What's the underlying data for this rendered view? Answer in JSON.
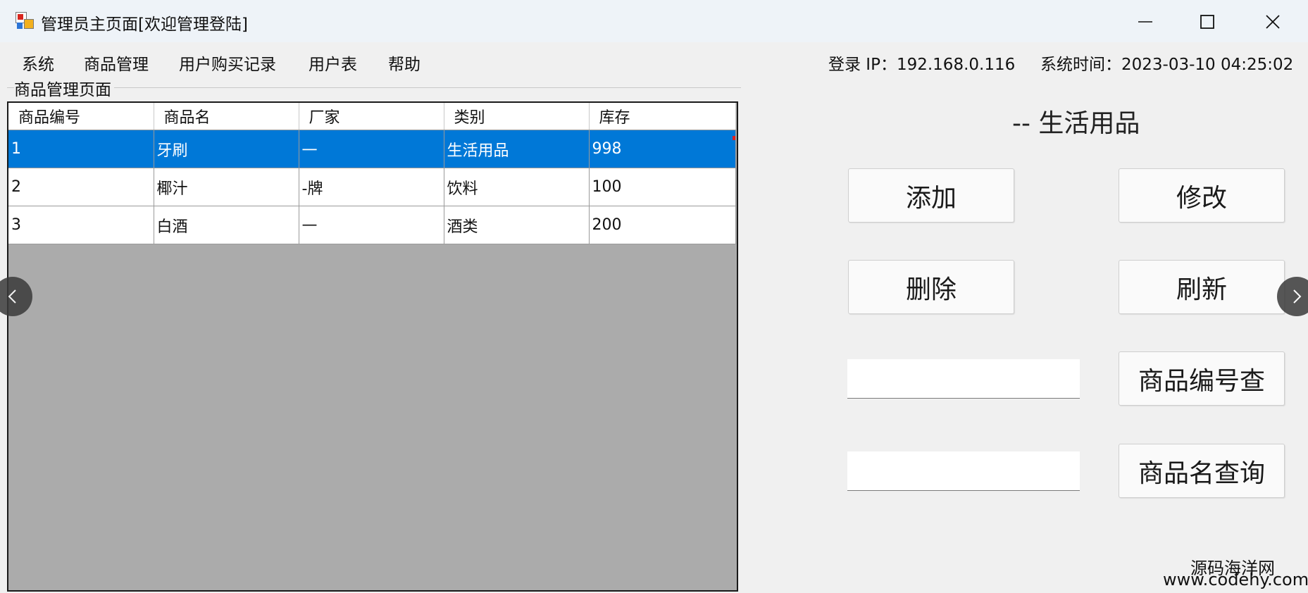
{
  "window": {
    "title": "管理员主页面[欢迎管理登陆]"
  },
  "menu": {
    "items": [
      "系统",
      "商品管理",
      "用户购买记录",
      "用户表",
      "帮助"
    ]
  },
  "status": {
    "login_ip": "登录 IP：192.168.0.116",
    "system_time": "系统时间：2023-03-10 04:25:02"
  },
  "group": {
    "label": "商品管理页面"
  },
  "table": {
    "columns": [
      "商品编号",
      "商品名",
      "厂家",
      "类别",
      "库存"
    ],
    "rows": [
      [
        "1",
        "牙刷",
        "一",
        "生活用品",
        "998"
      ],
      [
        "2",
        "椰汁",
        "-牌",
        "饮料",
        "100"
      ],
      [
        "3",
        "白酒",
        "—",
        "酒类",
        "200"
      ]
    ],
    "selected_row": 0
  },
  "panel": {
    "category_label": "-- 生活用品",
    "add_button": "添加",
    "edit_button": "修改",
    "delete_button": "删除",
    "refresh_button": "刷新",
    "id_search_value": "",
    "id_search_button": "商品编号查",
    "name_search_value": "",
    "name_search_button": "商品名查询"
  },
  "watermark": {
    "line1": "源码海洋网",
    "line2": "www.codehy.com"
  },
  "colors": {
    "selection": "#0078d7",
    "grid_background": "#ababab",
    "titlebar": "#eef3f8"
  }
}
